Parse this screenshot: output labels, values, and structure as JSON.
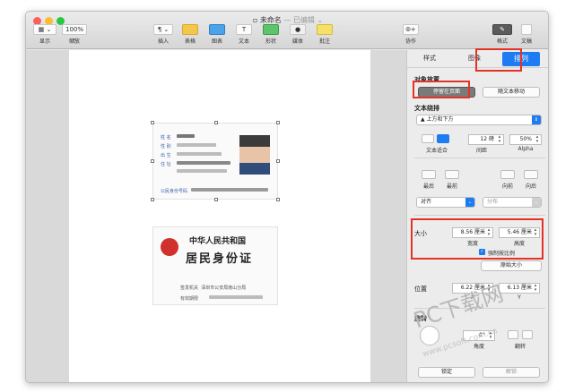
{
  "window": {
    "title": "未命名",
    "title_suffix": "— 已编辑 ",
    "title_chevron": "⌄"
  },
  "toolbar": {
    "view_icon": "▦ ⌄",
    "view_label": "显示",
    "zoom_value": "100% ⌄",
    "zoom_label": "缩放",
    "insert_icon": "¶ ⌄",
    "insert_label": "插入",
    "table_label": "表格",
    "chart_label": "图表",
    "text_icon": "T",
    "text_label": "文本",
    "shape_label": "形状",
    "media_label": "媒体",
    "comment_label": "批注",
    "collab_icon": "⦾+",
    "collab_label": "协作",
    "format_icon": "✎",
    "format_label": "格式",
    "document_label": "文稿"
  },
  "inspector": {
    "tabs": [
      "样式",
      "图像",
      "排列"
    ],
    "object_placement_label": "对象放置",
    "stay_on_page": "停留在页面",
    "move_with_text": "随文本移动",
    "text_wrap_label": "文本绕排",
    "wrap_value": "上方和下方",
    "text_fit_label": "文本适合",
    "spacing_value": "12 磅",
    "spacing_label": "间距",
    "alpha_value": "50%",
    "alpha_label": "Alpha",
    "back_label": "最后",
    "front_label": "最前",
    "forward_label": "向前",
    "backward_label": "向后",
    "align_value": "对齐",
    "distribute_value": "分布",
    "size_label": "大小",
    "width_value": "8.56 厘米",
    "width_label": "宽度",
    "height_value": "5.46 厘米",
    "height_label": "高度",
    "constrain_label": "强制按比例",
    "original_size": "原始大小",
    "position_label": "位置",
    "x_value": "6.22 厘米",
    "x_label": "X",
    "y_value": "6.13 厘米",
    "y_label": "Y",
    "rotate_label": "旋转",
    "angle_value": "0°",
    "angle_label": "角度",
    "flip_label": "翻转",
    "lock_label": "锁定",
    "unlock_label": "解锁"
  },
  "id_front": {
    "name_label": "姓 名",
    "gender_label": "性 别",
    "born_label": "出 生",
    "address_label": "住 址",
    "id_label": "公民身份号码"
  },
  "id_back": {
    "country": "中华人民共和国",
    "card_title": "居民身份证",
    "authority_label": "签发机关",
    "authority_value": "深圳市公安局南山分局",
    "validity_label": "有效期限"
  },
  "watermark": {
    "main": "PC下载网",
    "url": "www.pcsoft.com.cn"
  },
  "colors": {
    "accent": "#1e7cf2",
    "highlight_box": "#e53227"
  }
}
